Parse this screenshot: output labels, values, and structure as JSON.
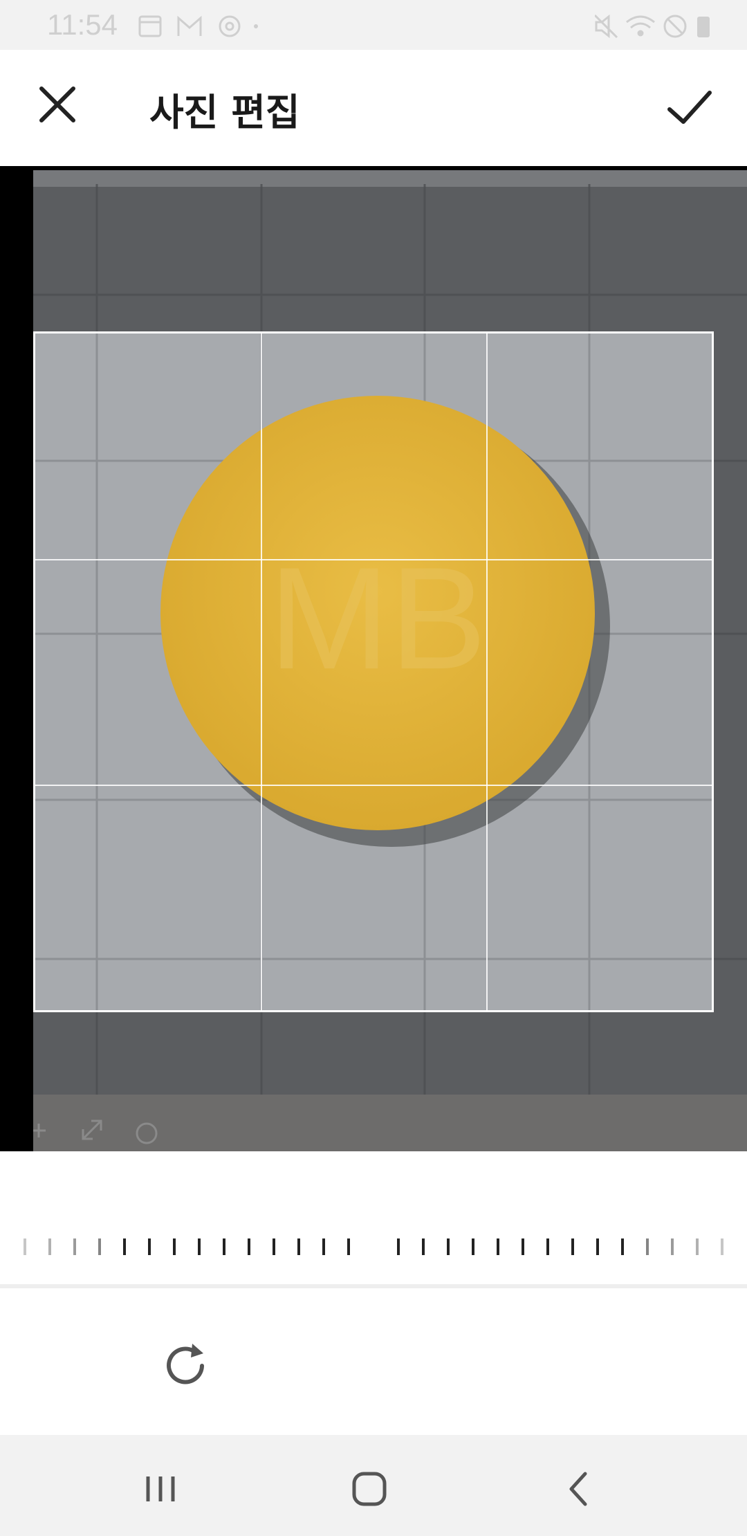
{
  "status_bar": {
    "time": "11:54",
    "left_icons": [
      "calendar-icon",
      "gmail-icon",
      "sync-icon",
      "dot-icon"
    ],
    "right_icons": [
      "mute-icon",
      "wifi-icon",
      "blocked-icon",
      "battery-icon"
    ]
  },
  "app_bar": {
    "title": "사진 편집",
    "close_icon": "close-icon",
    "confirm_icon": "check-icon"
  },
  "editor": {
    "photo_overlay_icons": [
      "plus-icon",
      "expand-icon",
      "rotate-small-icon"
    ],
    "grid": "3x3"
  },
  "tools": {
    "rotate_icon": "rotate-icon"
  },
  "nav_bar": {
    "icons": [
      "recents-icon",
      "home-icon",
      "back-icon"
    ]
  },
  "colors": {
    "accent": "#222222",
    "pill": "#e0b43a",
    "background": "#8a8d90",
    "status_bar": "#f2f2f2"
  }
}
